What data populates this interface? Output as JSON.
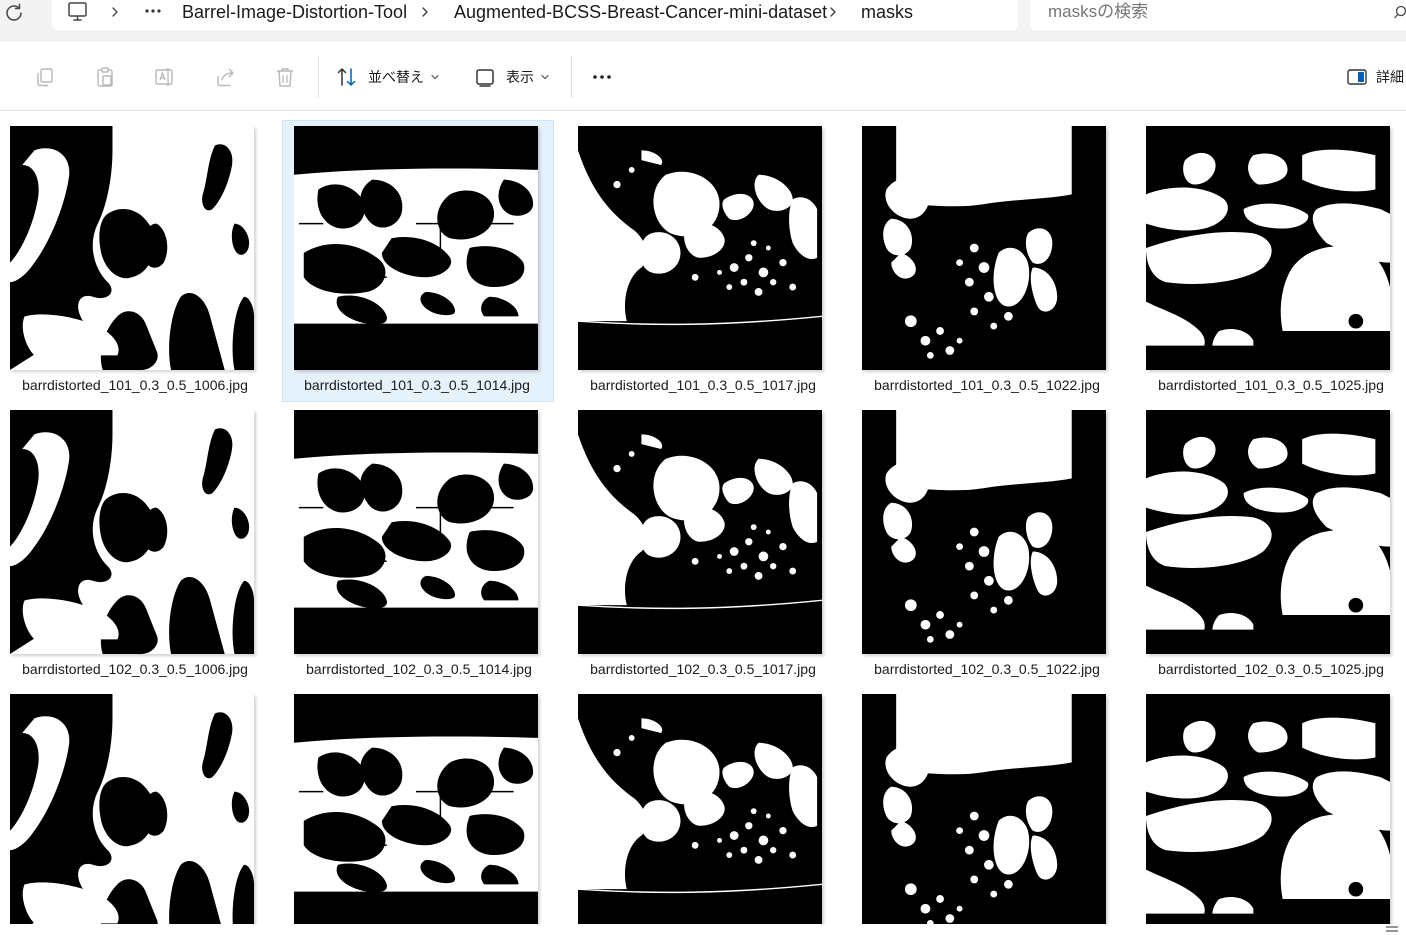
{
  "address": {
    "breadcrumbs": [
      "Barrel-Image-Distortion-Tool",
      "Augmented-BCSS-Breast-Cancer-mini-dataset",
      "masks"
    ],
    "search_placeholder": "masksの検索"
  },
  "toolbar": {
    "sort_label": "並べ替え",
    "view_label": "表示",
    "details_label": "詳細"
  },
  "files": [
    {
      "name": "barrdistorted_101_0.3_0.5_1006.jpg",
      "pattern": "A",
      "selected": false
    },
    {
      "name": "barrdistorted_101_0.3_0.5_1014.jpg",
      "pattern": "B",
      "selected": true
    },
    {
      "name": "barrdistorted_101_0.3_0.5_1017.jpg",
      "pattern": "C",
      "selected": false
    },
    {
      "name": "barrdistorted_101_0.3_0.5_1022.jpg",
      "pattern": "D",
      "selected": false
    },
    {
      "name": "barrdistorted_101_0.3_0.5_1025.jpg",
      "pattern": "E",
      "selected": false
    },
    {
      "name": "barrdistorted_102_0.3_0.5_1006.jpg",
      "pattern": "A",
      "selected": false
    },
    {
      "name": "barrdistorted_102_0.3_0.5_1014.jpg",
      "pattern": "B",
      "selected": false
    },
    {
      "name": "barrdistorted_102_0.3_0.5_1017.jpg",
      "pattern": "C",
      "selected": false
    },
    {
      "name": "barrdistorted_102_0.3_0.5_1022.jpg",
      "pattern": "D",
      "selected": false
    },
    {
      "name": "barrdistorted_102_0.3_0.5_1025.jpg",
      "pattern": "E",
      "selected": false
    },
    {
      "name": "",
      "pattern": "A",
      "selected": false
    },
    {
      "name": "",
      "pattern": "B",
      "selected": false
    },
    {
      "name": "",
      "pattern": "C",
      "selected": false
    },
    {
      "name": "",
      "pattern": "D",
      "selected": false
    },
    {
      "name": "",
      "pattern": "E",
      "selected": false
    }
  ],
  "icons": {
    "refresh": "refresh-icon",
    "pc": "this-pc-icon",
    "copy": "copy-icon",
    "paste": "paste-icon",
    "rename": "rename-icon",
    "share": "share-icon",
    "delete": "delete-icon",
    "sort": "sort-icon",
    "view": "view-icon",
    "more": "more-options-icon",
    "details": "details-pane-icon"
  },
  "colors": {
    "addressbar_bg": "#f3f3f3",
    "selection_bg": "#e5f1fb",
    "selection_border": "#cce4f7",
    "accent": "#005fb8"
  }
}
